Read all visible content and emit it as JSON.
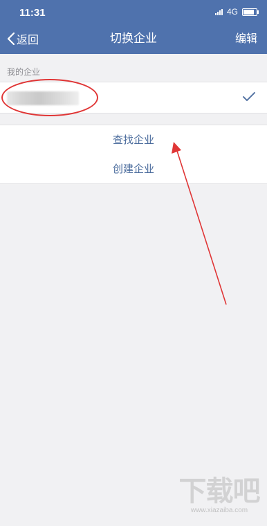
{
  "status_bar": {
    "time": "11:31",
    "network": "4G",
    "battery_level": 0.85
  },
  "nav": {
    "back_label": "返回",
    "title": "切换企业",
    "edit_label": "编辑"
  },
  "section": {
    "title": "我的企业"
  },
  "company": {
    "selected": true,
    "name_blurred": true
  },
  "actions": {
    "find_label": "查找企业",
    "create_label": "创建企业"
  },
  "annotations": {
    "highlight_color": "#e03636",
    "arrow_color": "#e03636"
  },
  "watermark": {
    "brand": "下载吧",
    "url": "www.xiazaiba.com"
  },
  "colors": {
    "header": "#4f72ad",
    "background": "#f1f1f3",
    "action_text": "#4a6b9c",
    "check": "#5a78a6"
  }
}
